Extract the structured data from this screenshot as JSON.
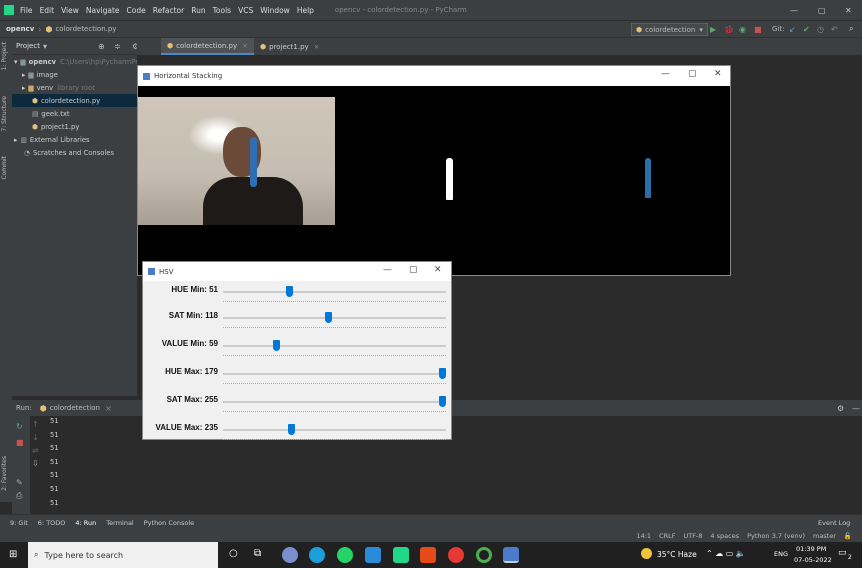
{
  "menubar": {
    "items": [
      "File",
      "Edit",
      "View",
      "Navigate",
      "Code",
      "Refactor",
      "Run",
      "Tools",
      "VCS",
      "Window",
      "Help"
    ],
    "title": "opencv - colordetection.py - PyCharm"
  },
  "nav": {
    "project": "opencv",
    "file": "colordetection.py",
    "run_config": "colordetection",
    "git": "Git:"
  },
  "project_panel": {
    "label": "Project",
    "tree": [
      {
        "label": "opencv",
        "hint": "C:\\Users\\hp\\PycharmProjects\\op..."
      },
      {
        "label": "image"
      },
      {
        "label": "venv",
        "hint": "library root"
      },
      {
        "label": "colordetection.py"
      },
      {
        "label": "geek.txt"
      },
      {
        "label": "project1.py"
      },
      {
        "label": "External Libraries"
      },
      {
        "label": "Scratches and Consoles"
      }
    ]
  },
  "side_tabs": [
    "1: Project",
    "7: Structure",
    "Commit",
    "2: Favorites"
  ],
  "editor_tabs": [
    "colordetection.py",
    "project1.py"
  ],
  "run": {
    "label": "Run:",
    "config": "colordetection",
    "output": [
      "51",
      "51",
      "51",
      "51",
      "51",
      "51",
      "51"
    ]
  },
  "stacking_window": {
    "title": "Horizontal Stacking"
  },
  "hsv_window": {
    "title": "HSV",
    "trackbars": [
      {
        "label": "HUE Min: 51",
        "pos": 0.29
      },
      {
        "label": "SAT Min: 118",
        "pos": 0.47
      },
      {
        "label": "VALUE Min: 59",
        "pos": 0.23
      },
      {
        "label": "HUE Max: 179",
        "pos": 1.0
      },
      {
        "label": "SAT Max: 255",
        "pos": 1.0
      },
      {
        "label": "VALUE Max: 235",
        "pos": 0.3
      }
    ]
  },
  "bottom_tabs": [
    "9: Git",
    "6: TODO",
    "4: Run",
    "Terminal",
    "Python Console"
  ],
  "event_log": "Event Log",
  "status": [
    "14:1",
    "CRLF",
    "UTF-8",
    "4 spaces",
    "Python 3.7 (venv)",
    "master"
  ],
  "taskbar": {
    "search_placeholder": "Type here to search",
    "weather": "35°C Haze",
    "lang": "ENG",
    "time": "01:39 PM",
    "date": "07-05-2022",
    "notif": "2"
  }
}
